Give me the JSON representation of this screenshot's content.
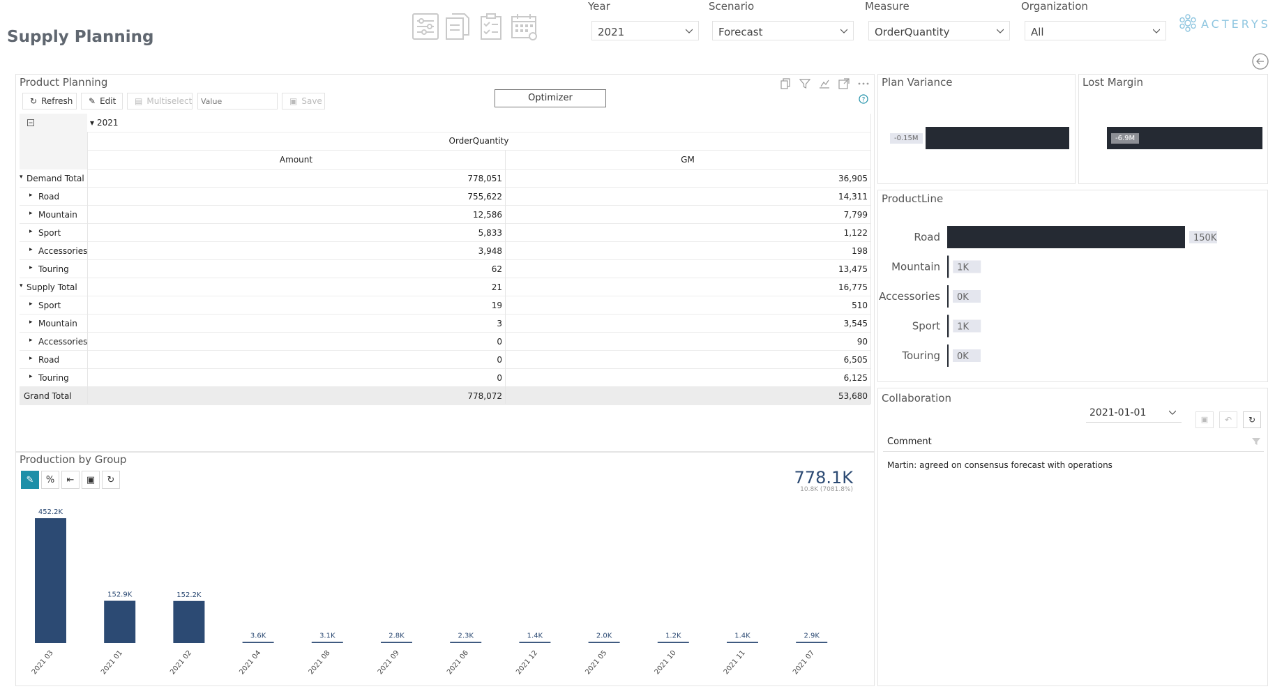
{
  "app": {
    "title": "Supply Planning",
    "brand": "ACTERYS"
  },
  "filters": [
    {
      "label": "Year",
      "value": "2021"
    },
    {
      "label": "Scenario",
      "value": "Forecast"
    },
    {
      "label": "Measure",
      "value": "OrderQuantity"
    },
    {
      "label": "Organization",
      "value": "All"
    }
  ],
  "top_icons": [
    "sliders-icon",
    "documents-icon",
    "checklist-icon",
    "calendar-icon"
  ],
  "product_planning": {
    "title": "Product Planning",
    "toolbar": {
      "refresh": "Refresh",
      "edit": "Edit",
      "multiselect": "Multiselect",
      "value_placeholder": "Value",
      "save": "Save"
    },
    "optimizer": "Optimizer",
    "header_icons": [
      "copy-icon",
      "filter-icon",
      "drill-icon",
      "expand-icon",
      "more-icon"
    ],
    "year": "2021",
    "measure": "OrderQuantity",
    "col_amount": "Amount",
    "col_gm": "GM",
    "rows": [
      {
        "label": "Demand Total",
        "level": 0,
        "amount": "778,051",
        "gm": "36,905"
      },
      {
        "label": "Road",
        "level": 1,
        "amount": "755,622",
        "gm": "14,311"
      },
      {
        "label": "Mountain",
        "level": 1,
        "amount": "12,586",
        "gm": "7,799"
      },
      {
        "label": "Sport",
        "level": 1,
        "amount": "5,833",
        "gm": "1,122"
      },
      {
        "label": "Accessories",
        "level": 1,
        "amount": "3,948",
        "gm": "198"
      },
      {
        "label": "Touring",
        "level": 1,
        "amount": "62",
        "gm": "13,475"
      },
      {
        "label": "Supply Total",
        "level": 0,
        "amount": "21",
        "gm": "16,775"
      },
      {
        "label": "Sport",
        "level": 1,
        "amount": "19",
        "gm": "510"
      },
      {
        "label": "Mountain",
        "level": 1,
        "amount": "3",
        "gm": "3,545"
      },
      {
        "label": "Accessories",
        "level": 1,
        "amount": "0",
        "gm": "90"
      },
      {
        "label": "Road",
        "level": 1,
        "amount": "0",
        "gm": "6,505"
      },
      {
        "label": "Touring",
        "level": 1,
        "amount": "0",
        "gm": "6,125"
      }
    ],
    "grand_total": {
      "label": "Grand Total",
      "amount": "778,072",
      "gm": "53,680"
    }
  },
  "plan_variance": {
    "title": "Plan Variance",
    "label": "-0.15M",
    "value": -0.15
  },
  "lost_margin": {
    "title": "Lost Margin",
    "label": "-6.9M",
    "value": -6.9
  },
  "production": {
    "title": "Production by Group",
    "kpi": "778.1K",
    "kpi_sub": "10.8K (7081.8%)",
    "tool_icons": [
      "pencil-icon",
      "percent-icon",
      "arrow-left-icon",
      "save-icon",
      "refresh-icon"
    ],
    "tool_glyphs": [
      "✎",
      "%",
      "⇤",
      "▣",
      "↻"
    ]
  },
  "collaboration": {
    "title": "Collaboration",
    "date": "2021-01-01",
    "comment_header": "Comment",
    "comment": "Martin: agreed on consensus forecast with operations"
  },
  "colors": {
    "bar_dark": "#252a33",
    "bar_navy": "#2c4a73",
    "accent_teal": "#1d8fa8",
    "brand": "#8fc6e0"
  },
  "chart_data": [
    {
      "type": "bar",
      "title": "Production by Group",
      "categories": [
        "2021 03",
        "2021 01",
        "2021 02",
        "2021 04",
        "2021 08",
        "2021 09",
        "2021 06",
        "2021 12",
        "2021 05",
        "2021 10",
        "2021 11",
        "2021 07"
      ],
      "values": [
        452.2,
        152.9,
        152.2,
        3.6,
        3.1,
        2.8,
        2.3,
        1.4,
        2.0,
        1.2,
        1.4,
        2.9
      ],
      "labels": [
        "452.2K",
        "152.9K",
        "152.2K",
        "3.6K",
        "3.1K",
        "2.8K",
        "2.3K",
        "1.4K",
        "2.0K",
        "1.2K",
        "1.4K",
        "2.9K"
      ],
      "ylim": [
        0,
        460
      ]
    },
    {
      "type": "bar",
      "title": "ProductLine",
      "orientation": "horizontal",
      "categories": [
        "Road",
        "Mountain",
        "Accessories",
        "Sport",
        "Touring"
      ],
      "values": [
        150,
        1,
        0,
        1,
        0
      ],
      "labels": [
        "150K",
        "1K",
        "0K",
        "1K",
        "0K"
      ]
    }
  ]
}
